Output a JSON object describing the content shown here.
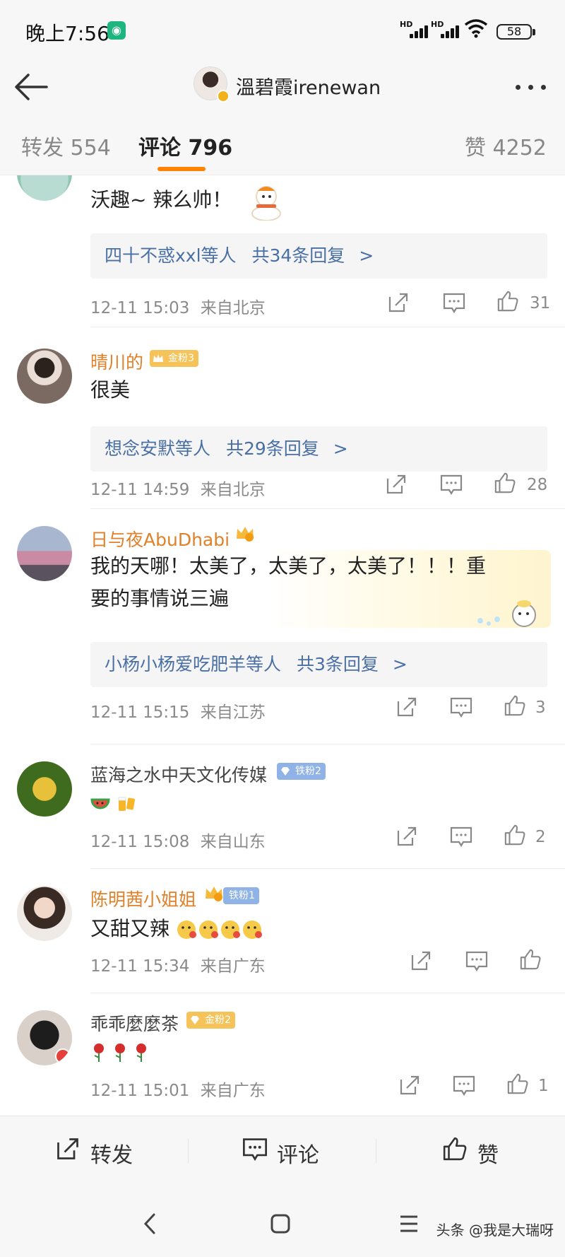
{
  "status_bar": {
    "time": "晚上7:56",
    "network_1": "HD",
    "network_2": "HD",
    "battery": "58"
  },
  "header": {
    "title": "溫碧霞irenewan"
  },
  "tabs": [
    {
      "label": "转发 554"
    },
    {
      "label": "评论 796"
    },
    {
      "label": "赞 4252"
    }
  ],
  "comments": [
    {
      "text": "沃趣~ 辣么帅！",
      "reply_user": "四十不惑xxl等人",
      "reply_count": "共34条回复",
      "chevron": ">",
      "time": "12-11 15:03",
      "location": "来自北京",
      "likes": "31"
    },
    {
      "user": "晴川的",
      "badge_level": "6",
      "badge": "金粉3",
      "text": "很美",
      "reply_user": "想念安默等人",
      "reply_count": "共29条回复",
      "chevron": ">",
      "time": "12-11 14:59",
      "location": "来自北京",
      "likes": "28"
    },
    {
      "user": "日与夜AbuDhabi",
      "badge_level": "6",
      "text_line1": "我的天哪！太美了，太美了，太美了！！！重",
      "text_line2": "要的事情说三遍",
      "reply_user": "小杨小杨爱吃肥羊等人",
      "reply_count": "共3条回复",
      "chevron": ">",
      "time": "12-11 15:15",
      "location": "来自江苏",
      "likes": "3"
    },
    {
      "user": "蓝海之水中天文化传媒",
      "badge": "铁粉2",
      "time": "12-11 15:08",
      "location": "来自山东",
      "likes": "2"
    },
    {
      "user": "陈明茜小姐姐",
      "badge_level": "6",
      "badge": "铁粉1",
      "text": "又甜又辣",
      "time": "12-11 15:34",
      "location": "来自广东",
      "likes": ""
    },
    {
      "user": "乖乖麼麼茶",
      "badge": "金粉2",
      "time": "12-11 15:01",
      "location": "来自广东",
      "likes": "1"
    }
  ],
  "action_bar": {
    "repost": "转发",
    "comment": "评论",
    "like": "赞"
  },
  "watermark": "头条 @我是大瑞呀",
  "colors": {
    "accent": "#ff8200",
    "link": "#4a6fa5",
    "username": "#e0812a",
    "meta": "#8a8a8a"
  }
}
